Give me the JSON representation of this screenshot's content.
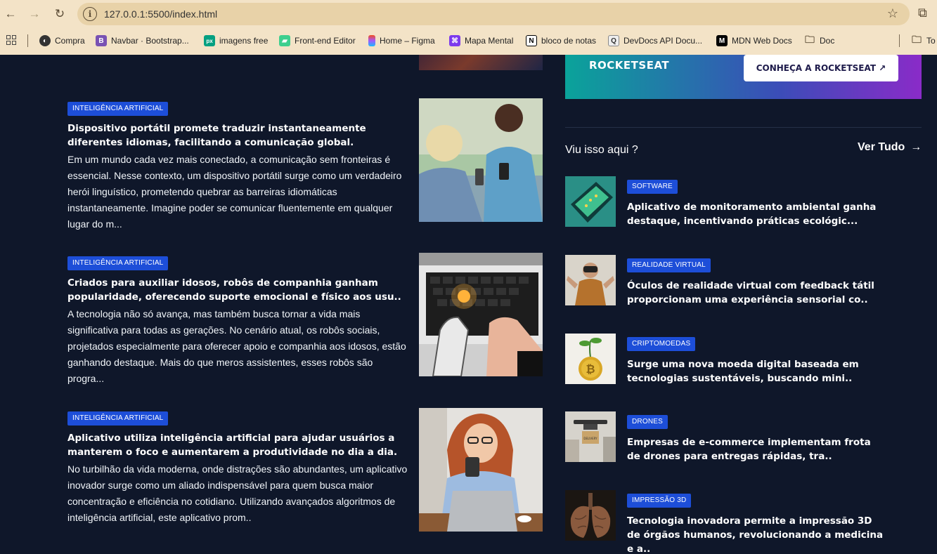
{
  "browser": {
    "url": "127.0.0.1:5500/index.html",
    "bookmarks": [
      {
        "label": "Compra",
        "icon": "globe-icon"
      },
      {
        "label": "Navbar · Bootstrap...",
        "icon": "bootstrap-icon"
      },
      {
        "label": "imagens free",
        "icon": "pexels-icon"
      },
      {
        "label": "Front-end Editor",
        "icon": "editor-icon"
      },
      {
        "label": "Home – Figma",
        "icon": "figma-icon"
      },
      {
        "label": "Mapa Mental",
        "icon": "mindmap-icon"
      },
      {
        "label": "bloco de notas",
        "icon": "notion-icon"
      },
      {
        "label": "DevDocs API Docu...",
        "icon": "devdocs-icon"
      },
      {
        "label": "MDN Web Docs",
        "icon": "mdn-icon"
      },
      {
        "label": "Doc",
        "icon": "folder-icon"
      },
      {
        "label": "To",
        "icon": "folder-icon"
      }
    ]
  },
  "articles": [
    {
      "tag": "INTELIGÊNCIA ARTIFICIAL",
      "title": "Dispositivo portátil promete traduzir instantaneamente diferentes idiomas, facilitando a comunicação global.",
      "text": "Em um mundo cada vez mais conectado, a comunicação sem fronteiras é essencial. Nesse contexto, um dispositivo portátil surge como um verdadeiro herói linguístico, prometendo quebrar as barreiras idiomáticas instantaneamente. Imagine poder se comunicar fluentemente em qualquer lugar do m..."
    },
    {
      "tag": "INTELIGÊNCIA ARTIFICIAL",
      "title": "Criados para auxiliar idosos, robôs de companhia ganham popularidade, oferecendo suporte emocional e físico aos usu..",
      "text": "A tecnologia não só avança, mas também busca tornar a vida mais significativa para todas as gerações. No cenário atual, os robôs sociais, projetados especialmente para oferecer apoio e companhia aos idosos, estão ganhando destaque. Mais do que meros assistentes, esses robôs são progra..."
    },
    {
      "tag": "INTELIGÊNCIA ARTIFICIAL",
      "title": "Aplicativo utiliza inteligência artificial para ajudar usuários a manterem o foco e aumentarem a produtividade no dia a dia.",
      "text": "No turbilhão da vida moderna, onde distrações são abundantes, um aplicativo inovador surge como um aliado indispensável para quem busca maior concentração e eficiência no cotidiano. Utilizando avançados algoritmos de inteligência artificial, este aplicativo prom.."
    }
  ],
  "banner": {
    "logo": "ROCKETSEAT",
    "button": "CONHEÇA A ROCKETSEAT ↗"
  },
  "sidebar": {
    "heading": "Viu isso aqui ?",
    "see_all": "Ver Tudo",
    "items": [
      {
        "tag": "SOFTWARE",
        "title": "Aplicativo de monitoramento ambiental ganha destaque, incentivando práticas ecológic..."
      },
      {
        "tag": "REALIDADE VIRTUAL",
        "title": "Óculos de realidade virtual com feedback tátil proporcionam uma experiência sensorial co.."
      },
      {
        "tag": "CRIPTOMOEDAS",
        "title": "Surge uma nova moeda digital baseada em tecnologias sustentáveis, buscando mini.."
      },
      {
        "tag": "DRONES",
        "title": "Empresas de e-commerce implementam frota de drones para entregas rápidas, tra.."
      },
      {
        "tag": "IMPRESSÃO 3D",
        "title": "Tecnologia inovadora permite a impressão 3D de órgãos humanos, revolucionando a medicina e a.."
      }
    ]
  },
  "colors": {
    "background": "#0f172a",
    "tag": "#1d4ed8",
    "chrome": "#f3e3c7"
  }
}
